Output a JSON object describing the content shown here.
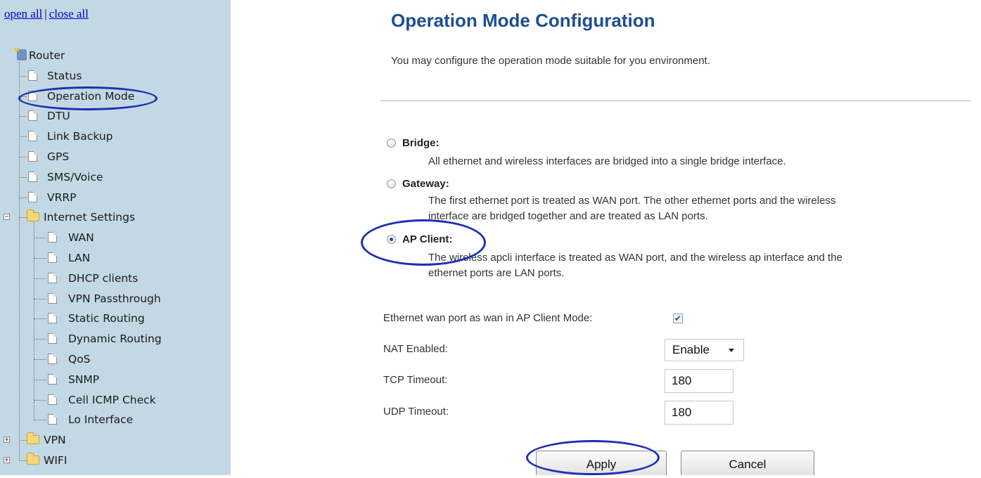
{
  "nav": {
    "open_all": "open all",
    "separator": "|",
    "close_all": "close all",
    "tree": [
      {
        "label": "Router",
        "icon": "router-icon",
        "level": 0
      },
      {
        "label": "Status",
        "icon": "page-icon",
        "level": 1
      },
      {
        "label": "Operation Mode",
        "icon": "page-icon",
        "level": 1,
        "selected": true
      },
      {
        "label": "DTU",
        "icon": "page-icon",
        "level": 1
      },
      {
        "label": "Link Backup",
        "icon": "page-icon",
        "level": 1
      },
      {
        "label": "GPS",
        "icon": "page-icon",
        "level": 1
      },
      {
        "label": "SMS/Voice",
        "icon": "page-icon",
        "level": 1
      },
      {
        "label": "VRRP",
        "icon": "page-icon",
        "level": 1
      },
      {
        "label": "Internet Settings",
        "icon": "folder-open-icon",
        "level": 1,
        "expanded": true
      },
      {
        "label": "WAN",
        "icon": "page-icon",
        "level": 2
      },
      {
        "label": "LAN",
        "icon": "page-icon",
        "level": 2
      },
      {
        "label": "DHCP clients",
        "icon": "page-icon",
        "level": 2
      },
      {
        "label": "VPN Passthrough",
        "icon": "page-icon",
        "level": 2
      },
      {
        "label": "Static Routing",
        "icon": "page-icon",
        "level": 2
      },
      {
        "label": "Dynamic Routing",
        "icon": "page-icon",
        "level": 2
      },
      {
        "label": "QoS",
        "icon": "page-icon",
        "level": 2
      },
      {
        "label": "SNMP",
        "icon": "page-icon",
        "level": 2
      },
      {
        "label": "Cell ICMP Check",
        "icon": "page-icon",
        "level": 2
      },
      {
        "label": "Lo Interface",
        "icon": "page-icon",
        "level": 2
      },
      {
        "label": "VPN",
        "icon": "folder-icon",
        "level": 1,
        "expanded": false
      },
      {
        "label": "WIFI",
        "icon": "folder-icon",
        "level": 1,
        "expanded": false
      }
    ]
  },
  "main": {
    "title": "Operation Mode Configuration",
    "intro": "You may configure the operation mode suitable for you environment.",
    "modes": [
      {
        "label": "Bridge:",
        "checked": false,
        "desc": [
          "All ethernet and wireless interfaces are bridged into a single bridge interface."
        ]
      },
      {
        "label": "Gateway:",
        "checked": false,
        "desc": [
          "The first ethernet port is treated as WAN port. The other ethernet ports and the wireless",
          "interface are bridged together and are treated as LAN ports."
        ]
      },
      {
        "label": "AP Client:",
        "checked": true,
        "desc": [
          "The wireless apcli interface is treated as WAN port, and the wireless ap interface and the",
          "ethernet ports are LAN ports."
        ]
      }
    ],
    "eth_wan_label": "Ethernet wan port as wan in AP Client Mode:",
    "eth_wan_checked": true,
    "nat_label": "NAT Enabled:",
    "nat_value": "Enable",
    "tcp_label": "TCP Timeout:",
    "tcp_value": "180",
    "udp_label": "UDP Timeout:",
    "udp_value": "180",
    "apply_label": "Apply",
    "cancel_label": "Cancel"
  },
  "colors": {
    "sidebar_bg": "#c3d8e5",
    "title": "#1d4f91",
    "link": "#0000cc",
    "annotation": "#1d2fb3"
  }
}
